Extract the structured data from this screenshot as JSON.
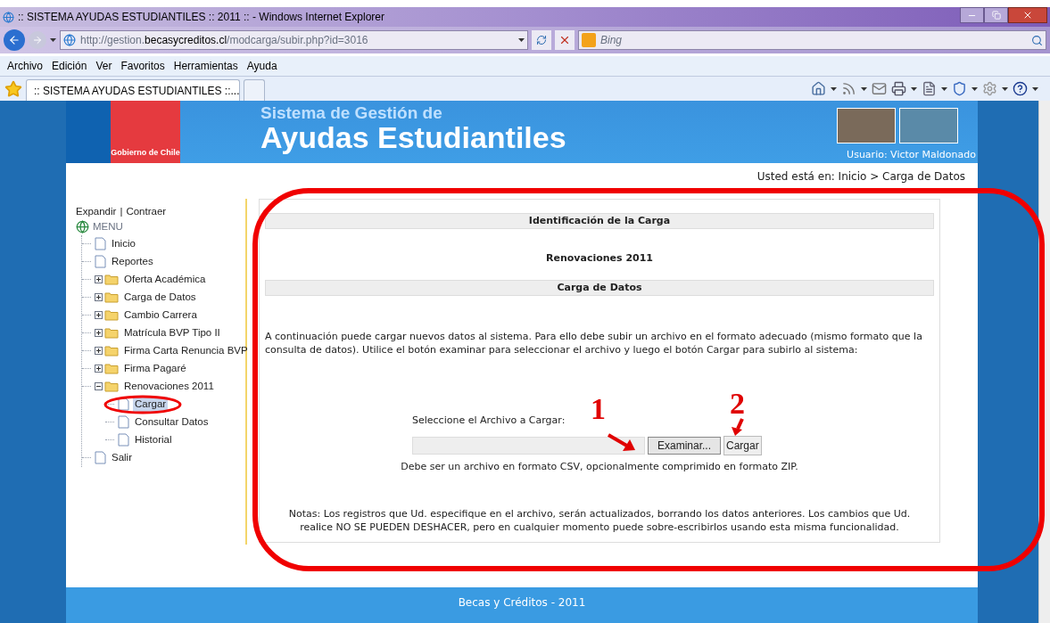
{
  "window": {
    "title": ":: SISTEMA AYUDAS ESTUDIANTILES :: 2011 :: - Windows Internet Explorer"
  },
  "address_bar": {
    "prefix": "http://gestion.",
    "domain": "becasycreditos.cl",
    "path": "/modcarga/subir.php?id=3016"
  },
  "search_box": {
    "placeholder": "Bing"
  },
  "menu_bar": [
    "Archivo",
    "Edición",
    "Ver",
    "Favoritos",
    "Herramientas",
    "Ayuda"
  ],
  "tabs": [
    {
      "label": ":: SISTEMA AYUDAS ESTUDIANTILES ::...",
      "selected": true
    }
  ],
  "page": {
    "logo_caption": "Gobierno de Chile",
    "header_subtitle": "Sistema de Gestión de",
    "header_title": "Ayudas Estudiantiles",
    "user": "Usuario: Victor Maldonado",
    "breadcrumb": "Usted está en: Inicio > Carga de Datos",
    "sidebar": {
      "expand": "Expandir",
      "separator": "|",
      "collapse": "Contraer",
      "menu_label": "MENU",
      "items": [
        {
          "kind": "page",
          "label": "Inicio",
          "selected": false
        },
        {
          "kind": "page",
          "label": "Reportes",
          "selected": false
        },
        {
          "kind": "folder",
          "label": "Oferta Académica",
          "expanded": false
        },
        {
          "kind": "folder",
          "label": "Carga de Datos",
          "expanded": false
        },
        {
          "kind": "folder",
          "label": "Cambio Carrera",
          "expanded": false
        },
        {
          "kind": "folder",
          "label": "Matrícula BVP Tipo II",
          "expanded": false
        },
        {
          "kind": "folder",
          "label": "Firma Carta Renuncia BVP",
          "expanded": false
        },
        {
          "kind": "folder",
          "label": "Firma Pagaré",
          "expanded": false
        },
        {
          "kind": "folder",
          "label": "Renovaciones 2011",
          "expanded": true,
          "children": [
            {
              "kind": "page",
              "label": "Cargar",
              "selected": true
            },
            {
              "kind": "page",
              "label": "Consultar Datos",
              "selected": false
            },
            {
              "kind": "page",
              "label": "Historial",
              "selected": false
            }
          ]
        },
        {
          "kind": "page",
          "label": "Salir",
          "selected": false
        }
      ]
    },
    "panel": {
      "section_1": "Identificación de la Carga",
      "process_name": "Renovaciones 2011",
      "section_2": "Carga de Datos",
      "intro": "A continuación puede cargar nuevos datos al sistema. Para ello debe subir un archivo en el formato adecuado (mismo formato que la consulta de datos). Utilice el botón examinar para seleccionar el archivo y luego el botón Cargar para subirlo al sistema:",
      "file_label": "Seleccione el Archivo a Cargar:",
      "browse_button": "Examinar...",
      "upload_button": "Cargar",
      "hint": "Debe ser un archivo en formato CSV, opcionalmente comprimido en formato ZIP.",
      "notes": "Notas: Los registros que Ud. especifique en el archivo, serán actualizados, borrando los datos anteriores. Los cambios que Ud. realice NO SE PUEDEN DESHACER, pero en cualquier momento puede sobre-escribirlos usando esta misma funcionalidad."
    },
    "footer": "Becas y Créditos - 2011"
  },
  "annotations": [
    {
      "label": "1"
    },
    {
      "label": "2"
    }
  ]
}
